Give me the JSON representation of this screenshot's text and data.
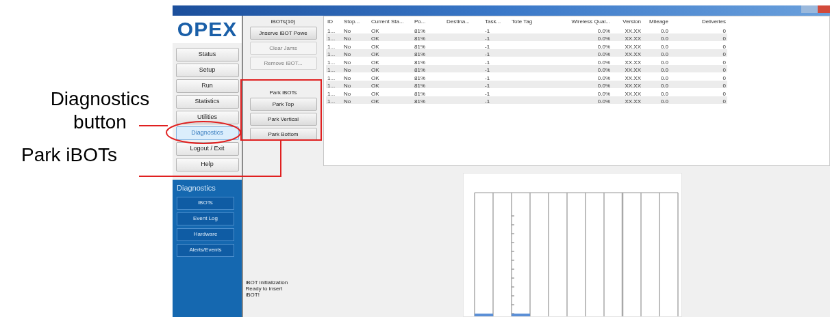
{
  "callouts": [
    {
      "lines": [
        "Diagnostics",
        "button"
      ]
    },
    {
      "lines": [
        "Park iBOTs"
      ]
    }
  ],
  "nav": {
    "logo": "OPEX",
    "items": [
      {
        "label": "Status",
        "selected": false
      },
      {
        "label": "Setup",
        "selected": false
      },
      {
        "label": "Run",
        "selected": false
      },
      {
        "label": "Statistics",
        "selected": false
      },
      {
        "label": "Utilities",
        "selected": false
      },
      {
        "label": "Diagnostics",
        "selected": true
      },
      {
        "label": "Logout / Exit",
        "selected": false
      },
      {
        "label": "Help",
        "selected": false
      }
    ]
  },
  "sub_nav": {
    "title": "Diagnostics",
    "items": [
      {
        "label": "iBOTs",
        "selected": false
      },
      {
        "label": "Event Log",
        "selected": false
      },
      {
        "label": "Hardware",
        "selected": false
      },
      {
        "label": "Alerts/Events",
        "selected": false
      }
    ]
  },
  "controls": {
    "title": "iBOTs(10)",
    "buttons": [
      {
        "label": "Jnserve iBOT Powe",
        "disabled": false
      },
      {
        "label": "Clear Jams",
        "disabled": true
      },
      {
        "label": "Remove iBOT...",
        "disabled": true
      }
    ],
    "park": {
      "title": "Park iBOTs",
      "buttons": [
        {
          "label": "Park Top",
          "disabled": false
        },
        {
          "label": "Park Vertical",
          "disabled": false
        },
        {
          "label": "Park Bottom",
          "disabled": false
        }
      ]
    },
    "status_lines": [
      "iBOT initialization",
      "Ready to insert",
      "iBOT!"
    ]
  },
  "table": {
    "columns": [
      "ID",
      "Stop...",
      "Current Sta...",
      "Po...",
      "Destina...",
      "Task...",
      "Tote Tag",
      "Wireless Qual...",
      "Version",
      "Mileage",
      "Deliveries"
    ],
    "rows": [
      [
        "1...",
        "No",
        "OK",
        "81%",
        "",
        "-1",
        "",
        "0.0%",
        "XX.XX",
        "0.0",
        "0"
      ],
      [
        "1...",
        "No",
        "OK",
        "81%",
        "",
        "-1",
        "",
        "0.0%",
        "XX.XX",
        "0.0",
        "0"
      ],
      [
        "1...",
        "No",
        "OK",
        "81%",
        "",
        "-1",
        "",
        "0.0%",
        "XX.XX",
        "0.0",
        "0"
      ],
      [
        "1...",
        "No",
        "OK",
        "81%",
        "",
        "-1",
        "",
        "0.0%",
        "XX.XX",
        "0.0",
        "0"
      ],
      [
        "1...",
        "No",
        "OK",
        "81%",
        "",
        "-1",
        "",
        "0.0%",
        "XX.XX",
        "0.0",
        "0"
      ],
      [
        "1...",
        "No",
        "OK",
        "81%",
        "",
        "-1",
        "",
        "0.0%",
        "XX.XX",
        "0.0",
        "0"
      ],
      [
        "1...",
        "No",
        "OK",
        "81%",
        "",
        "-1",
        "",
        "0.0%",
        "XX.XX",
        "0.0",
        "0"
      ],
      [
        "1...",
        "No",
        "OK",
        "81%",
        "",
        "-1",
        "",
        "0.0%",
        "XX.XX",
        "0.0",
        "0"
      ],
      [
        "1...",
        "No",
        "OK",
        "81%",
        "",
        "-1",
        "",
        "0.0%",
        "XX.XX",
        "0.0",
        "0"
      ],
      [
        "1...",
        "No",
        "OK",
        "81%",
        "",
        "-1",
        "",
        "0.0%",
        "XX.XX",
        "0.0",
        "0"
      ]
    ]
  }
}
